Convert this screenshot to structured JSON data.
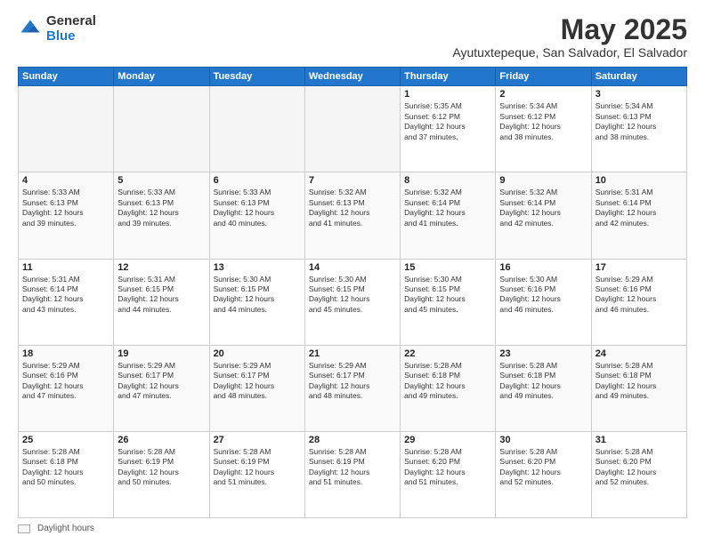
{
  "logo": {
    "general": "General",
    "blue": "Blue"
  },
  "header": {
    "month": "May 2025",
    "location": "Ayutuxtepeque, San Salvador, El Salvador"
  },
  "weekdays": [
    "Sunday",
    "Monday",
    "Tuesday",
    "Wednesday",
    "Thursday",
    "Friday",
    "Saturday"
  ],
  "footer": {
    "label": "Daylight hours"
  },
  "weeks": [
    [
      {
        "day": "",
        "info": ""
      },
      {
        "day": "",
        "info": ""
      },
      {
        "day": "",
        "info": ""
      },
      {
        "day": "",
        "info": ""
      },
      {
        "day": "1",
        "info": "Sunrise: 5:35 AM\nSunset: 6:12 PM\nDaylight: 12 hours\nand 37 minutes."
      },
      {
        "day": "2",
        "info": "Sunrise: 5:34 AM\nSunset: 6:12 PM\nDaylight: 12 hours\nand 38 minutes."
      },
      {
        "day": "3",
        "info": "Sunrise: 5:34 AM\nSunset: 6:13 PM\nDaylight: 12 hours\nand 38 minutes."
      }
    ],
    [
      {
        "day": "4",
        "info": "Sunrise: 5:33 AM\nSunset: 6:13 PM\nDaylight: 12 hours\nand 39 minutes."
      },
      {
        "day": "5",
        "info": "Sunrise: 5:33 AM\nSunset: 6:13 PM\nDaylight: 12 hours\nand 39 minutes."
      },
      {
        "day": "6",
        "info": "Sunrise: 5:33 AM\nSunset: 6:13 PM\nDaylight: 12 hours\nand 40 minutes."
      },
      {
        "day": "7",
        "info": "Sunrise: 5:32 AM\nSunset: 6:13 PM\nDaylight: 12 hours\nand 41 minutes."
      },
      {
        "day": "8",
        "info": "Sunrise: 5:32 AM\nSunset: 6:14 PM\nDaylight: 12 hours\nand 41 minutes."
      },
      {
        "day": "9",
        "info": "Sunrise: 5:32 AM\nSunset: 6:14 PM\nDaylight: 12 hours\nand 42 minutes."
      },
      {
        "day": "10",
        "info": "Sunrise: 5:31 AM\nSunset: 6:14 PM\nDaylight: 12 hours\nand 42 minutes."
      }
    ],
    [
      {
        "day": "11",
        "info": "Sunrise: 5:31 AM\nSunset: 6:14 PM\nDaylight: 12 hours\nand 43 minutes."
      },
      {
        "day": "12",
        "info": "Sunrise: 5:31 AM\nSunset: 6:15 PM\nDaylight: 12 hours\nand 44 minutes."
      },
      {
        "day": "13",
        "info": "Sunrise: 5:30 AM\nSunset: 6:15 PM\nDaylight: 12 hours\nand 44 minutes."
      },
      {
        "day": "14",
        "info": "Sunrise: 5:30 AM\nSunset: 6:15 PM\nDaylight: 12 hours\nand 45 minutes."
      },
      {
        "day": "15",
        "info": "Sunrise: 5:30 AM\nSunset: 6:15 PM\nDaylight: 12 hours\nand 45 minutes."
      },
      {
        "day": "16",
        "info": "Sunrise: 5:30 AM\nSunset: 6:16 PM\nDaylight: 12 hours\nand 46 minutes."
      },
      {
        "day": "17",
        "info": "Sunrise: 5:29 AM\nSunset: 6:16 PM\nDaylight: 12 hours\nand 46 minutes."
      }
    ],
    [
      {
        "day": "18",
        "info": "Sunrise: 5:29 AM\nSunset: 6:16 PM\nDaylight: 12 hours\nand 47 minutes."
      },
      {
        "day": "19",
        "info": "Sunrise: 5:29 AM\nSunset: 6:17 PM\nDaylight: 12 hours\nand 47 minutes."
      },
      {
        "day": "20",
        "info": "Sunrise: 5:29 AM\nSunset: 6:17 PM\nDaylight: 12 hours\nand 48 minutes."
      },
      {
        "day": "21",
        "info": "Sunrise: 5:29 AM\nSunset: 6:17 PM\nDaylight: 12 hours\nand 48 minutes."
      },
      {
        "day": "22",
        "info": "Sunrise: 5:28 AM\nSunset: 6:18 PM\nDaylight: 12 hours\nand 49 minutes."
      },
      {
        "day": "23",
        "info": "Sunrise: 5:28 AM\nSunset: 6:18 PM\nDaylight: 12 hours\nand 49 minutes."
      },
      {
        "day": "24",
        "info": "Sunrise: 5:28 AM\nSunset: 6:18 PM\nDaylight: 12 hours\nand 49 minutes."
      }
    ],
    [
      {
        "day": "25",
        "info": "Sunrise: 5:28 AM\nSunset: 6:18 PM\nDaylight: 12 hours\nand 50 minutes."
      },
      {
        "day": "26",
        "info": "Sunrise: 5:28 AM\nSunset: 6:19 PM\nDaylight: 12 hours\nand 50 minutes."
      },
      {
        "day": "27",
        "info": "Sunrise: 5:28 AM\nSunset: 6:19 PM\nDaylight: 12 hours\nand 51 minutes."
      },
      {
        "day": "28",
        "info": "Sunrise: 5:28 AM\nSunset: 6:19 PM\nDaylight: 12 hours\nand 51 minutes."
      },
      {
        "day": "29",
        "info": "Sunrise: 5:28 AM\nSunset: 6:20 PM\nDaylight: 12 hours\nand 51 minutes."
      },
      {
        "day": "30",
        "info": "Sunrise: 5:28 AM\nSunset: 6:20 PM\nDaylight: 12 hours\nand 52 minutes."
      },
      {
        "day": "31",
        "info": "Sunrise: 5:28 AM\nSunset: 6:20 PM\nDaylight: 12 hours\nand 52 minutes."
      }
    ]
  ]
}
